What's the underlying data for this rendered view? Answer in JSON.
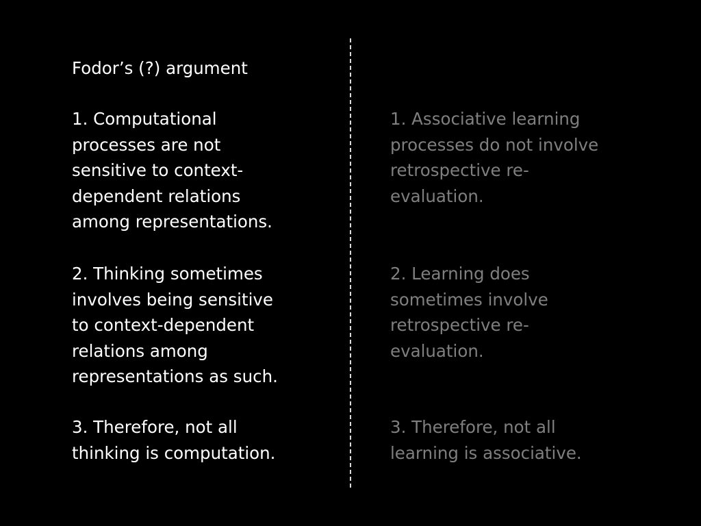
{
  "slide": {
    "title": "Fodor’s (?) argument",
    "left_points": [
      {
        "lines": [
          "1.  Computational",
          "processes are not",
          "sensitive to context-",
          "dependent relations",
          "among representations."
        ]
      },
      {
        "lines": [
          "2.  Thinking sometimes",
          "involves being sensitive",
          "to context-dependent",
          "relations among",
          "representations as such."
        ]
      },
      {
        "lines": [
          "3.  Therefore, not all",
          "thinking is computation."
        ]
      }
    ],
    "right_points": [
      {
        "lines": [
          "1.  Associative learning",
          "processes do not involve",
          "retrospective re-",
          "evaluation."
        ]
      },
      {
        "lines": [
          "2.  Learning does",
          "sometimes involve",
          "retrospective re-",
          "evaluation."
        ]
      },
      {
        "lines": [
          "3.  Therefore, not all",
          "learning is associative."
        ]
      }
    ],
    "colors": {
      "background": "#000000",
      "left_text": "#ffffff",
      "right_text": "#7f7f7f",
      "divider": "#d9d9d9"
    }
  }
}
